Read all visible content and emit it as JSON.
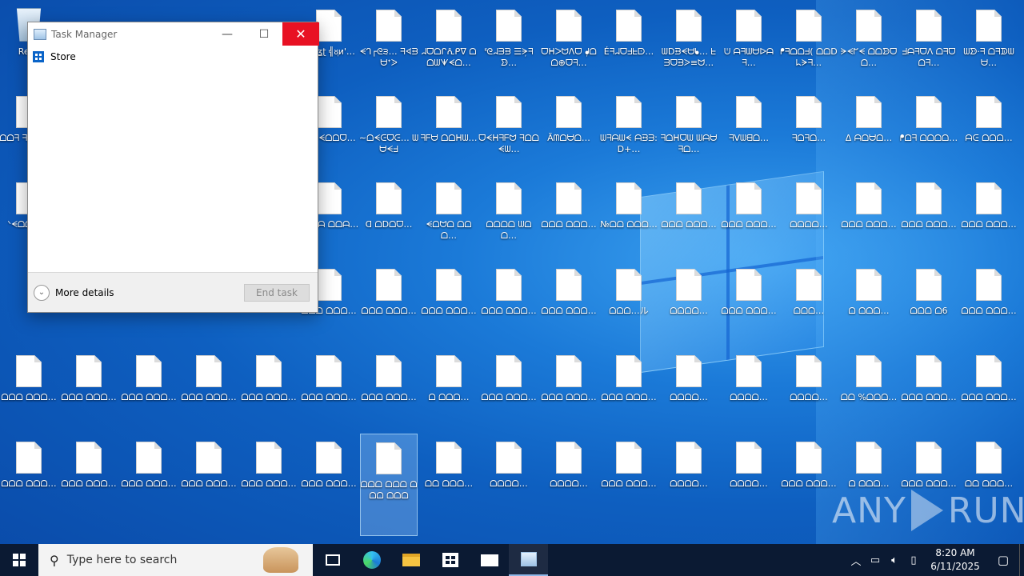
{
  "desktop": {
    "recycle_bin_label": "Recy",
    "icons": [
      {
        "col": 5,
        "row": 0,
        "label": "ℹ︎/ɪ͓ʊʓʈ ╣ᴕ᷊ᴎ'…"
      },
      {
        "col": 6,
        "row": 0,
        "label": "ᗕᒉ┌ᘓ੩… ᖷᗏᗲᗨᕀᐷ"
      },
      {
        "col": 7,
        "row": 0,
        "label": "ᖹᗜᗝᒋᕅᑭᐁ ᗝᗝᗯᗖᗕᗝ…"
      },
      {
        "col": 8,
        "row": 0,
        "label": "ᓫᘓᖹᗱᗲ ☰ᗒ᷊ᖷᗦ…"
      },
      {
        "col": 9,
        "row": 0,
        "label": "ᗜᕼᐳᗢᐱᗜ ᖱ᷊ᗝᗝ⊕ᗜᖷ…"
      },
      {
        "col": 10,
        "row": 0,
        "label": "Éᖷᖹᗜᖵᖶᗠ…"
      },
      {
        "col": 11,
        "row": 0,
        "label": "ᗯᗞᗲᗕᗨᖲ… ᖶᗱᗜᗲᐷ≡ᗢ…"
      },
      {
        "col": 12,
        "row": 0,
        "label": "ᕫ ᗩᖷᗯᗨᐅᗩᖷ…"
      },
      {
        "col": 13,
        "row": 0,
        "label": "ᖰᖷᗝᗝᖵ( ᗝᗝᗞᖺᗒᖷ…"
      },
      {
        "col": 14,
        "row": 0,
        "label": "ᗒᗕᖸᗕ ᗝᗝᗦᗜᗝ…"
      },
      {
        "col": 15,
        "row": 0,
        "label": "ᖵᗩᖷᗜᐱ ᗝᖷᗜᗝᖷ…"
      },
      {
        "col": 16,
        "row": 0,
        "label": "ᗯᗦ·ᖷ ᗝᖷᗫᗯᗨ…"
      },
      {
        "col": 0,
        "row": 1,
        "label": "ᗝᗝᖷ ᖷᗝᗫᗩ…"
      },
      {
        "col": 5,
        "row": 1,
        "label": "ᕮᗝ ᗕᗝᗝᗜ…"
      },
      {
        "col": 6,
        "row": 1,
        "label": "∼ᗝᗕᕮᗜᕮ… ᗯᗨᗕᖵ"
      },
      {
        "col": 7,
        "row": 1,
        "label": "ᖷᖴᗨ ᗝᗝᕼᗯ…"
      },
      {
        "col": 8,
        "row": 1,
        "label": "ᗜᗕᕼᖷᖴᗢ ᖷᗝᗝᗕᗯ…"
      },
      {
        "col": 9,
        "row": 1,
        "label": "Ãᗰᗝᗨᗝ…"
      },
      {
        "col": 10,
        "row": 1,
        "label": "ᗯᖷᗩᗯᗕ ᗩᗲᗱ:ᗞ+…"
      },
      {
        "col": 11,
        "row": 1,
        "label": "ᖷᗝᕼᗜᗯ ᗯᗩᗨᖷᗝ…"
      },
      {
        "col": 12,
        "row": 1,
        "label": "ᖷᐯᗯᗺᗝ…"
      },
      {
        "col": 13,
        "row": 1,
        "label": "ᖷᗝᖷᗝ…"
      },
      {
        "col": 14,
        "row": 1,
        "label": "ᐃ ᗩᗝᗨᗝ…"
      },
      {
        "col": 15,
        "row": 1,
        "label": "ᖰᗝᖷ ᗝᗝᗝᗝ…"
      },
      {
        "col": 16,
        "row": 1,
        "label": "ᗩᕮ ᗝᗝᗝ…"
      },
      {
        "col": 0,
        "row": 2,
        "label": "ᐠᗕᗝᗝ ᗯ…"
      },
      {
        "col": 5,
        "row": 2,
        "label": "ᖷᗝᗯᗩ ᗝᗝᗩ…"
      },
      {
        "col": 6,
        "row": 2,
        "label": "ᗡ ᗝᗞᗝᗜ…"
      },
      {
        "col": 7,
        "row": 2,
        "label": "ᗕᗝᗢᗝ ᗝᗝᗝ…"
      },
      {
        "col": 8,
        "row": 2,
        "label": "ᗝᗝᗝᗝ ᗯᗝᗝ…"
      },
      {
        "col": 9,
        "row": 2,
        "label": "ᗝᗝᗝ ᗝᗝᗝ…"
      },
      {
        "col": 10,
        "row": 2,
        "label": "№ᗝᗝ ᗝᗝᗝ…"
      },
      {
        "col": 11,
        "row": 2,
        "label": "ᗝᗝᗝ ᗝᗝᗝ…"
      },
      {
        "col": 12,
        "row": 2,
        "label": "ᗝᗝᗝ ᗝᗝᗝ…"
      },
      {
        "col": 13,
        "row": 2,
        "label": "ᗝᗝᗝᗝ…"
      },
      {
        "col": 14,
        "row": 2,
        "label": "ᗝᗝᗝ ᗝᗝᗝ…"
      },
      {
        "col": 15,
        "row": 2,
        "label": "ᗝᗝᗝ ᗝᗝᗝ…"
      },
      {
        "col": 16,
        "row": 2,
        "label": "ᗝᗝᗝ ᗝᗝᗝ…"
      },
      {
        "col": 5,
        "row": 3,
        "label": "ᗝᗝᗝ ᗝᗝᗝ…"
      },
      {
        "col": 6,
        "row": 3,
        "label": "ᗝᗝᗝ ᗝᗝᗝ…"
      },
      {
        "col": 7,
        "row": 3,
        "label": "ᗝᗝᗝ ᗝᗝᗝ…"
      },
      {
        "col": 8,
        "row": 3,
        "label": "ᗝᗝᗝ ᗝᗝᗝ…"
      },
      {
        "col": 9,
        "row": 3,
        "label": "ᗝᗝᗝ ᗝᗝᗝ…"
      },
      {
        "col": 10,
        "row": 3,
        "label": "ᗝᗝᗝ…ル"
      },
      {
        "col": 11,
        "row": 3,
        "label": "ᗝᗝᗝᗝ…"
      },
      {
        "col": 12,
        "row": 3,
        "label": "ᗝᗝᗝ ᗝᗝᗝ…"
      },
      {
        "col": 13,
        "row": 3,
        "label": "ᗝᗝᗝ…"
      },
      {
        "col": 14,
        "row": 3,
        "label": "ᗝ ᗝᗝᗝ…"
      },
      {
        "col": 15,
        "row": 3,
        "label": "ᗝᗝᗝ ᗝ6"
      },
      {
        "col": 16,
        "row": 3,
        "label": "ᗝᗝᗝ ᗝᗝᗝ…"
      },
      {
        "col": 0,
        "row": 4,
        "label": "ᗝᗝᗝ ᗝᗝᗝ…"
      },
      {
        "col": 1,
        "row": 4,
        "label": "ᗝᗝᗝ ᗝᗝᗝ…"
      },
      {
        "col": 2,
        "row": 4,
        "label": "ᗝᗝᗝ ᗝᗝᗝ…"
      },
      {
        "col": 3,
        "row": 4,
        "label": "ᗝᗝᗝ ᗝᗝᗝ…"
      },
      {
        "col": 4,
        "row": 4,
        "label": "ᗝᗝᗝ ᗝᗝᗝ…"
      },
      {
        "col": 5,
        "row": 4,
        "label": "ᗝᗝᗝ ᗝᗝᗝ…"
      },
      {
        "col": 6,
        "row": 4,
        "label": "ᗝᗝᗝ ᗝᗝᗝ…"
      },
      {
        "col": 7,
        "row": 4,
        "label": "ᗝ ᗝᗝᗝ…"
      },
      {
        "col": 8,
        "row": 4,
        "label": "ᗝᗝᗝ ᗝᗝᗝ…"
      },
      {
        "col": 9,
        "row": 4,
        "label": "ᗝᗝᗝ ᗝᗝᗝ…"
      },
      {
        "col": 10,
        "row": 4,
        "label": "ᗝᗝᗝ ᗝᗝᗝ…"
      },
      {
        "col": 11,
        "row": 4,
        "label": "ᗝᗝᗝᗝ…"
      },
      {
        "col": 12,
        "row": 4,
        "label": "ᗝᗝᗝᗝ…"
      },
      {
        "col": 13,
        "row": 4,
        "label": "ᗝᗝᗝᗝ…"
      },
      {
        "col": 14,
        "row": 4,
        "label": "ᗝᗝ %ᗝᗝᗝ…"
      },
      {
        "col": 15,
        "row": 4,
        "label": "ᗝᗝᗝ ᗝᗝᗝ…"
      },
      {
        "col": 16,
        "row": 4,
        "label": "ᗝᗝᗝ ᗝᗝᗝ…"
      },
      {
        "col": 0,
        "row": 5,
        "label": "ᗝᗝᗝ ᗝᗝᗝ…"
      },
      {
        "col": 1,
        "row": 5,
        "label": "ᗝᗝᗝ ᗝᗝᗝ…"
      },
      {
        "col": 2,
        "row": 5,
        "label": "ᗝᗝᗝ ᗝᗝᗝ…"
      },
      {
        "col": 3,
        "row": 5,
        "label": "ᗝᗝᗝ ᗝᗝᗝ…"
      },
      {
        "col": 4,
        "row": 5,
        "label": "ᗝᗝᗝ ᗝᗝᗝ…"
      },
      {
        "col": 5,
        "row": 5,
        "label": "ᗝᗝᗝ ᗝᗝᗝ…"
      },
      {
        "col": 6,
        "row": 5,
        "label": "ᗝᗝᗝ ᗝᗝᗝ ᗝᗝᗝ ᗝᗝᗝ",
        "selected": true
      },
      {
        "col": 7,
        "row": 5,
        "label": "ᗝᗝ ᗝᗝᗝ…"
      },
      {
        "col": 8,
        "row": 5,
        "label": "ᗝᗝᗝᗝ…"
      },
      {
        "col": 9,
        "row": 5,
        "label": "ᗝᗝᗝᗝ…"
      },
      {
        "col": 10,
        "row": 5,
        "label": "ᗝᗝᗝ ᗝᗝᗝ…"
      },
      {
        "col": 11,
        "row": 5,
        "label": "ᗝᗝᗝᗝ…"
      },
      {
        "col": 12,
        "row": 5,
        "label": "ᗝᗝᗝᗝ…"
      },
      {
        "col": 13,
        "row": 5,
        "label": "ᗝᗝᗝ ᗝᗝᗝ…"
      },
      {
        "col": 14,
        "row": 5,
        "label": "ᗝ ᗝᗝᗝ…"
      },
      {
        "col": 15,
        "row": 5,
        "label": "ᗝᗝᗝ ᗝᗝᗝ…"
      },
      {
        "col": 16,
        "row": 5,
        "label": "ᗝᗝ ᗝᗝᗝ…"
      }
    ]
  },
  "task_manager": {
    "title": "Task Manager",
    "min_glyph": "—",
    "max_glyph": "☐",
    "close_glyph": "✕",
    "apps": [
      {
        "label": "Store"
      }
    ],
    "more_details_label": "More details",
    "end_task_label": "End task"
  },
  "watermark": {
    "left": "ANY",
    "right": "RUN"
  },
  "taskbar": {
    "search_placeholder": "Type here to search",
    "time": "8:20 AM",
    "date": "6/11/2025",
    "tray_icons": [
      "chevron-up-icon",
      "network-icon",
      "volume-icon",
      "device-icon"
    ]
  }
}
